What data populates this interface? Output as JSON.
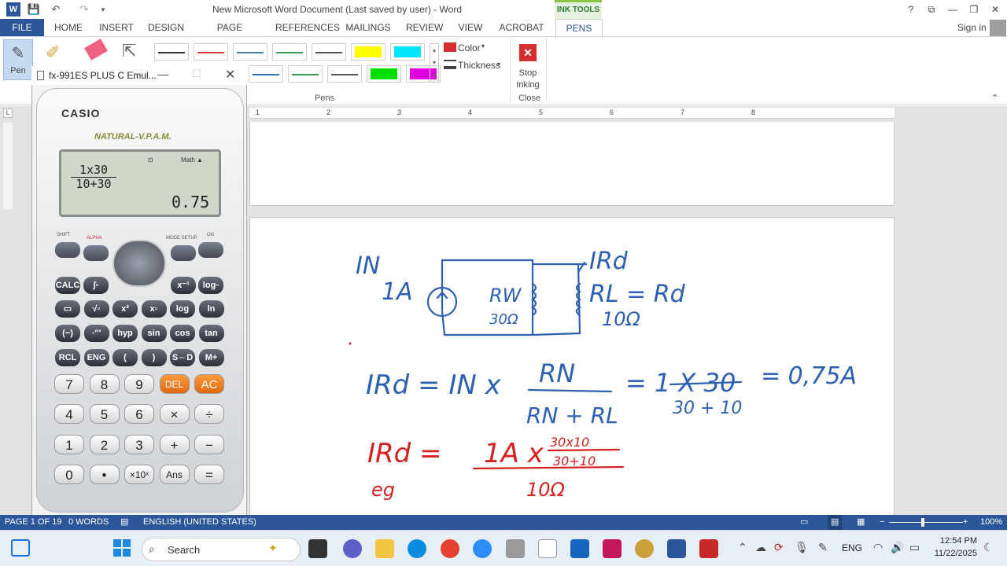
{
  "titlebar": {
    "title": "New Microsoft Word Document (Last saved by user) - Word",
    "contextual_tab": "INK TOOLS",
    "help": "?"
  },
  "tabs": [
    "HOME",
    "INSERT",
    "DESIGN",
    "PAGE LAYOUT",
    "REFERENCES",
    "MAILINGS",
    "REVIEW",
    "VIEW",
    "ACROBAT",
    "PENS"
  ],
  "file_tab": "FILE",
  "sign_in": "Sign in",
  "ribbon": {
    "pen_label": "Pen",
    "color_label": "Color",
    "thickness_label": "Thickness",
    "stop_label": "Stop Inking",
    "group_pens": "Pens",
    "group_close": "Close",
    "pen_colors_row1": [
      "#333333",
      "#d04040",
      "#4a7fb0",
      "#3a9a5a",
      "#555555",
      "#ffff00",
      "#00e5ff"
    ],
    "pen_colors_row2": [
      "#2f6fb7",
      "#3a9a5a",
      "#555555",
      "#00e000",
      "#e000e0"
    ]
  },
  "ruler": [
    "1",
    "2",
    "3",
    "4",
    "5",
    "6",
    "7",
    "8"
  ],
  "calculator": {
    "window_title": "fx-991ES PLUS C Emul...",
    "brand": "CASIO",
    "tagline": "NATURAL-V.P.A.M.",
    "numerator": "1x30",
    "denominator": "10+30",
    "result": "0.75",
    "math_indicator": "Math ▲",
    "keys_fn": [
      [
        "CALC",
        "∫▫",
        "x⁻¹",
        "log▫"
      ],
      [
        "▭",
        "√▫",
        "x²",
        "x▫",
        "log",
        "ln"
      ],
      [
        "(−)",
        "◦'''",
        "hyp",
        "sin",
        "cos",
        "tan"
      ],
      [
        "RCL",
        "ENG",
        "(",
        ")",
        "S⇔D",
        "M+"
      ]
    ],
    "keys_main": [
      [
        "7",
        "8",
        "9",
        "DEL",
        "AC"
      ],
      [
        "4",
        "5",
        "6",
        "×",
        "÷"
      ],
      [
        "1",
        "2",
        "3",
        "+",
        "−"
      ],
      [
        "0",
        "•",
        "×10ˣ",
        "Ans",
        "="
      ]
    ],
    "labels_top": [
      "SHIFT",
      "ALPHA",
      "MODE SETUP",
      "ON"
    ]
  },
  "ink": {
    "color_blue": "#2d5fb2",
    "color_red": "#d62020",
    "text_in": "IN",
    "text_1a": "1A",
    "text_rw": "RW",
    "text_30": "30Ω",
    "text_ird": "IRd",
    "text_rl": "RL = Rd",
    "text_10": "10Ω",
    "eq1_left": "IRd = IN x",
    "eq1_num": "RN",
    "eq1_den": "RN + RL",
    "eq1_mid": "= 1 X 30",
    "eq1_den2": "30 + 10",
    "eq1_result": "= 0,75A",
    "eq2_left": "IRd =",
    "eq2_num": "1A x",
    "eq2_frac_top": "30x10",
    "eq2_frac_bot": "30+10",
    "eq2_den": "10Ω",
    "eq2_note": "eg"
  },
  "status": {
    "page": "PAGE 1 OF 19",
    "words": "0 WORDS",
    "language": "ENGLISH (UNITED STATES)",
    "zoom": "100%"
  },
  "taskbar": {
    "search_placeholder": "Search",
    "lang": "ENG",
    "time": "12:54 PM",
    "date": "11/22/2025"
  }
}
